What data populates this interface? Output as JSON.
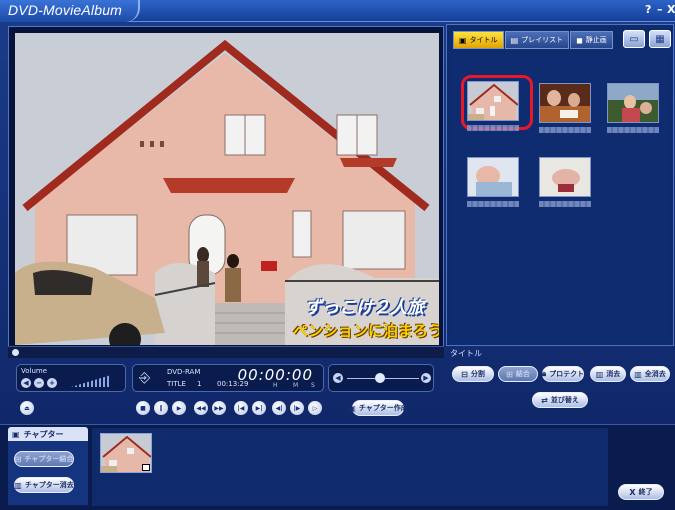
{
  "app": {
    "title": "DVD-MovieAlbum",
    "help": "?",
    "minimize": "–",
    "close": "X"
  },
  "video": {
    "caption_top": "ずっこけ２人旅",
    "caption_bottom": "ペンションに泊まろう"
  },
  "panel": {
    "tabs": [
      {
        "label": "タイトル",
        "icon": "camera-icon",
        "active": true
      },
      {
        "label": "プレイリスト",
        "icon": "playlist-icon",
        "active": false
      },
      {
        "label": "静止画",
        "icon": "photo-icon",
        "active": false
      }
    ],
    "section_label": "タイトル"
  },
  "volume": {
    "label": "Volume"
  },
  "disc_info": {
    "media": "DVD-RAM",
    "title_label": "TITLE",
    "title_number": "1",
    "duration": "00:13:29",
    "time": "00:00:00",
    "h": "H",
    "m": "M",
    "s": "S"
  },
  "buttons": {
    "chapter_create": "チャプター作成",
    "split": "分割",
    "combine": "結合",
    "protect": "プロテクト",
    "delete": "消去",
    "delete_all": "全消去",
    "reorder": "並び替え",
    "chapter_combine": "チャプター結合",
    "chapter_delete": "チャプター消去",
    "exit": "終了",
    "exit_mark": "X"
  },
  "chapter": {
    "header": "チャプター"
  },
  "colors": {
    "accent_tab": "#ffd21f",
    "selection_ring": "#e8182a",
    "window_bg": "#1b3c8a"
  }
}
